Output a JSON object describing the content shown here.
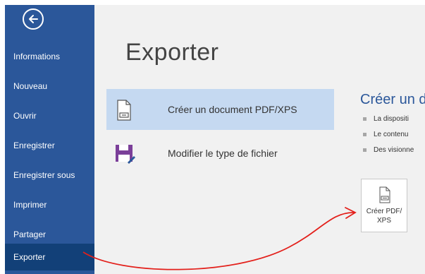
{
  "sidebar": {
    "items": [
      {
        "label": "Informations"
      },
      {
        "label": "Nouveau"
      },
      {
        "label": "Ouvrir"
      },
      {
        "label": "Enregistrer"
      },
      {
        "label": "Enregistrer sous"
      },
      {
        "label": "Imprimer"
      },
      {
        "label": "Partager"
      },
      {
        "label": "Exporter",
        "active": true
      }
    ]
  },
  "main": {
    "title": "Exporter",
    "options": [
      {
        "label": "Créer un document PDF/XPS",
        "icon": "pdf-document-icon",
        "selected": true
      },
      {
        "label": "Modifier le type de fichier",
        "icon": "save-as-icon",
        "selected": false
      }
    ]
  },
  "panel": {
    "title": "Créer un d",
    "bullets": [
      "La dispositi",
      "Le contenu",
      "Des visionne"
    ],
    "button_label": "Créer PDF/\nXPS"
  },
  "colors": {
    "sidebar": "#2b579a",
    "sidebar_active": "#124078",
    "selected_option": "#c5d9f1",
    "accent": "#2b579a",
    "annotation_arrow": "#e3201b"
  }
}
